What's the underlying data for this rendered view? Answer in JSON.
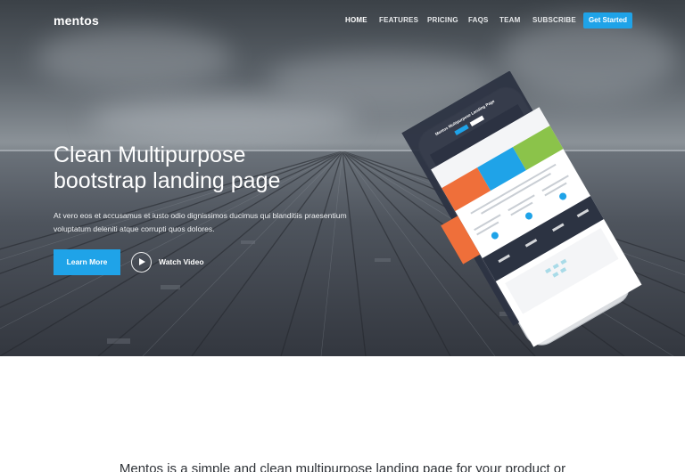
{
  "brand": {
    "logo": "mentos"
  },
  "nav": {
    "items": [
      {
        "label": "HOME",
        "active": true
      },
      {
        "label": "FEATURES",
        "active": false
      },
      {
        "label": "PRICING",
        "active": false
      },
      {
        "label": "FAQS",
        "active": false
      },
      {
        "label": "TEAM",
        "active": false
      },
      {
        "label": "SUBSCRIBE",
        "active": false
      }
    ],
    "cta_label": "Get Started"
  },
  "hero": {
    "title_line1": "Clean Multipurpose",
    "title_line2": "bootstrap landing page",
    "description_line1": "At vero eos et accusamus et iusto odio dignissimos ducimus qui blanditiis praesentium",
    "description_line2": "voluptatum deleniti atque corrupti quos dolores.",
    "primary_button": "Learn More",
    "video_link": "Watch Video"
  },
  "mockup": {
    "screen_title": "Mentos Multipurpose Landing Page"
  },
  "intro": {
    "text": "Mentos is a simple and clean multipurpose landing page for your product or"
  },
  "colors": {
    "accent": "#1fa3e8",
    "orange": "#ef6f3a",
    "green": "#8bc34a",
    "dark_navy": "#2c3342"
  }
}
